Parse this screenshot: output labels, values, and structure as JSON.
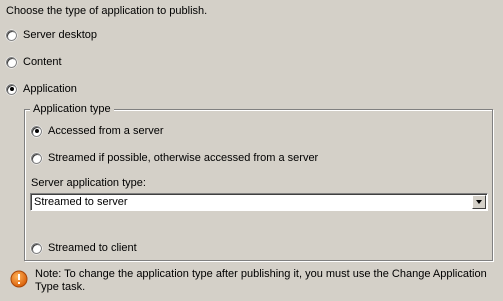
{
  "heading": "Choose the type of application to publish.",
  "publish_type": {
    "options": [
      {
        "label": "Server desktop",
        "checked": false
      },
      {
        "label": "Content",
        "checked": false
      },
      {
        "label": "Application",
        "checked": true
      }
    ]
  },
  "application_type": {
    "group_label": "Application type",
    "options": [
      {
        "label": "Accessed from a server",
        "checked": true
      },
      {
        "label": "Streamed if possible, otherwise accessed from a server",
        "checked": false
      }
    ],
    "server_app_type_label": "Server application type:",
    "server_app_type_value": "Streamed to server",
    "streamed_to_client": {
      "label": "Streamed to client",
      "checked": false
    }
  },
  "note": "Note: To change the application type after publishing it, you must use the Change Application Type task.",
  "icons": {
    "radio": "radio-button",
    "dropdown": "chevron-down-icon",
    "info": "info-icon"
  },
  "colors": {
    "background": "#d4d0c8",
    "info_icon": "#e2700f"
  }
}
